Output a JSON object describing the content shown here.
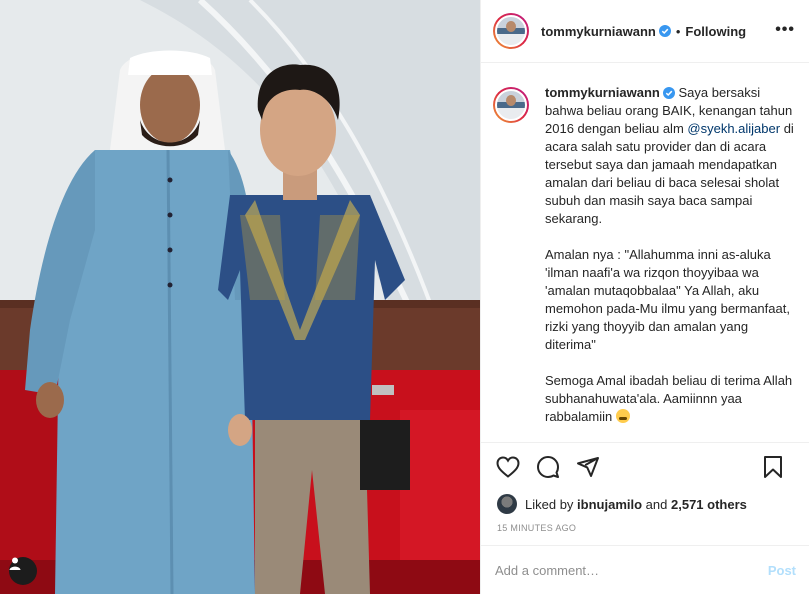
{
  "post": {
    "username": "tommykurniawann",
    "separator": "•",
    "follow_state": "Following",
    "more_label": "•••"
  },
  "caption": {
    "username": "tommykurniawann",
    "text_1": " Saya bersaksi bahwa beliau orang BAIK, kenangan tahun 2016 dengan beliau alm ",
    "mention": "@syekh.alijaber",
    "text_2": " di acara salah satu provider dan di acara tersebut saya dan jamaah mendapatkan amalan dari beliau di baca selesai sholat subuh dan masih saya baca sampai sekarang.\n\nAmalan nya : \"Allahumma inni as-aluka 'ilman naafi'a wa rizqon thoyyibaa wa 'amalan mutaqobbalaa\" Ya Allah, aku memohon pada-Mu ilmu yang bermanfaat, rizki yang thoyyib dan amalan yang diterima\"\n\nSemoga Amal ibadah beliau di terima Allah subhanahuwata'ala. Aamiinnn yaa rabbalamiin "
  },
  "likes": {
    "prefix": "Liked by ",
    "user": "ibnujamilo",
    "middle": " and ",
    "count": "2,571 others"
  },
  "timestamp": "15 MINUTES AGO",
  "comment": {
    "placeholder": "Add a comment…",
    "post_label": "Post"
  },
  "icons": [
    "heart-icon",
    "comment-icon",
    "share-icon",
    "bookmark-icon",
    "verified-badge-icon",
    "user-tag-icon",
    "crying-emoji-icon"
  ],
  "colors": {
    "verified": "#3897f0",
    "mention": "#00376b",
    "post_disabled": "#b2dffc",
    "muted": "#8e8e8e"
  }
}
